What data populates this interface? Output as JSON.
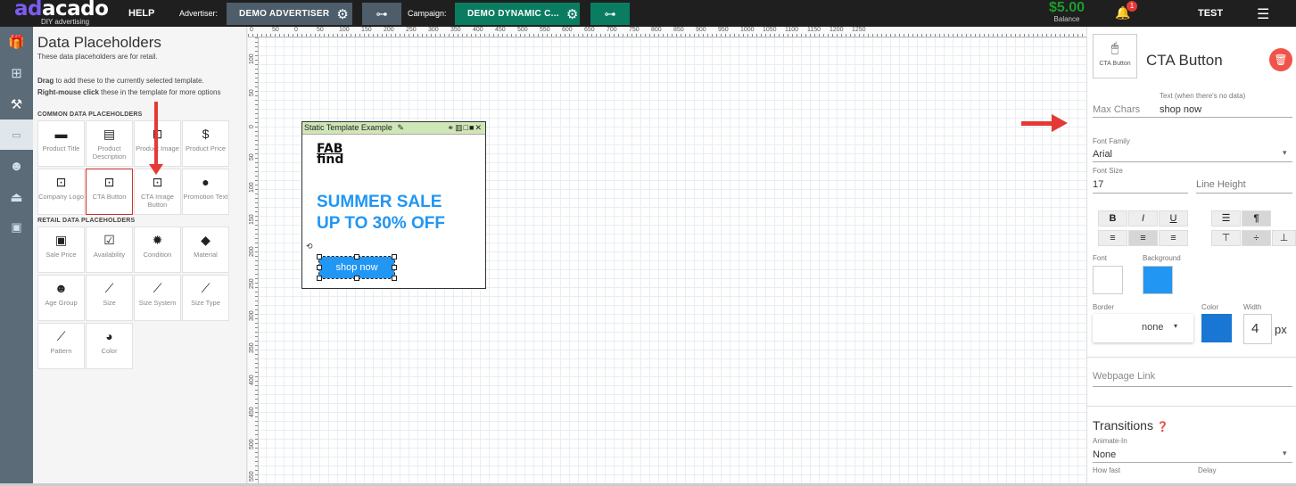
{
  "topbar": {
    "logo_ad": "ad",
    "logo_acado": "acado",
    "logo_tagline": "DIY advertising",
    "help": "HELP",
    "advertiser_label": "Advertiser:",
    "advertiser_value": "DEMO ADVERTISER",
    "campaign_label": "Campaign:",
    "campaign_value": "DEMO DYNAMIC C...",
    "balance_amount": "$5.00",
    "balance_label": "Balance",
    "notification_count": "1",
    "user": "TEST"
  },
  "rail": {
    "icons": [
      "gift-icon",
      "add-element-icon",
      "tools-icon",
      "placeholder-icon",
      "smiley-icon",
      "stamp-icon",
      "twitter-icon"
    ],
    "active_index": 3
  },
  "panel": {
    "title": "Data Placeholders",
    "subtitle": "These data placeholders are for retail.",
    "drag_bold": "Drag",
    "drag_rest": "to add these to the currently selected template.",
    "right_bold": "Right-mouse click",
    "right_rest": "these in the template for more options",
    "common_header": "COMMON DATA PLACEHOLDERS",
    "retail_header": "RETAIL DATA PLACEHOLDERS",
    "common": [
      {
        "label": "Product Title",
        "icon": "product-title-icon"
      },
      {
        "label": "Product Description",
        "icon": "description-icon"
      },
      {
        "label": "Product Image",
        "icon": "image-icon"
      },
      {
        "label": "Product Price",
        "icon": "dollar-icon"
      },
      {
        "label": "Company Logo",
        "icon": "logo-image-icon"
      },
      {
        "label": "CTA Button",
        "icon": "click-button-icon"
      },
      {
        "label": "CTA Image Button",
        "icon": "click-image-icon"
      },
      {
        "label": "Promotion Text",
        "icon": "speech-bubble-icon"
      }
    ],
    "retail": [
      {
        "label": "Sale Price",
        "icon": "money-icon"
      },
      {
        "label": "Availability",
        "icon": "clipboard-check-icon"
      },
      {
        "label": "Condition",
        "icon": "badge-icon"
      },
      {
        "label": "Material",
        "icon": "diamond-icon"
      },
      {
        "label": "Age Group",
        "icon": "people-icon"
      },
      {
        "label": "Size",
        "icon": "ruler-icon"
      },
      {
        "label": "Size System",
        "icon": "ruler-icon"
      },
      {
        "label": "Size Type",
        "icon": "ruler-icon"
      },
      {
        "label": "Pattern",
        "icon": "brush-icon"
      },
      {
        "label": "Color",
        "icon": "palette-icon"
      }
    ],
    "selected": "CTA Button"
  },
  "canvas": {
    "top_ticks": [
      "0",
      "50",
      "0",
      "50",
      "100",
      "150",
      "200",
      "250",
      "300",
      "350",
      "400",
      "450",
      "500",
      "550",
      "600",
      "650",
      "700",
      "750",
      "800",
      "850",
      "900",
      "950",
      "1000",
      "1050",
      "1100",
      "1150",
      "1200",
      "1250"
    ],
    "left_ticks": [
      "100",
      "50",
      "0",
      "50",
      "100",
      "150",
      "200",
      "250",
      "300",
      "350",
      "400",
      "450",
      "500",
      "550"
    ],
    "template_title": "Static Template Example",
    "brand_line1": "FAB",
    "brand_line2": "find",
    "headline_line1": "SUMMER SALE",
    "headline_line2": "UP TO 30% OFF",
    "cta_text": "shop now"
  },
  "properties": {
    "element_preview_label": "CTA Button",
    "title": "CTA Button",
    "max_chars_label": "Max Chars",
    "text_label": "Text (when there's no data)",
    "text_value": "shop now",
    "font_family_label": "Font Family",
    "font_family_value": "Arial",
    "font_size_label": "Font Size",
    "font_size_value": "17",
    "line_height_label": "Line Height",
    "font_color_label": "Font",
    "background_label": "Background",
    "font_color": "#ffffff",
    "background_color": "#2196f3",
    "border_label": "Border",
    "border_value": "none",
    "border_color_label": "Color",
    "border_color": "#1976d2",
    "width_label": "Width",
    "width_value": "4",
    "width_unit": "px",
    "webpage_link_placeholder": "Webpage Link",
    "transitions_title": "Transitions",
    "animate_in_label": "Animate-In",
    "animate_in_value": "None",
    "how_fast_label": "How fast",
    "delay_label": "Delay"
  }
}
